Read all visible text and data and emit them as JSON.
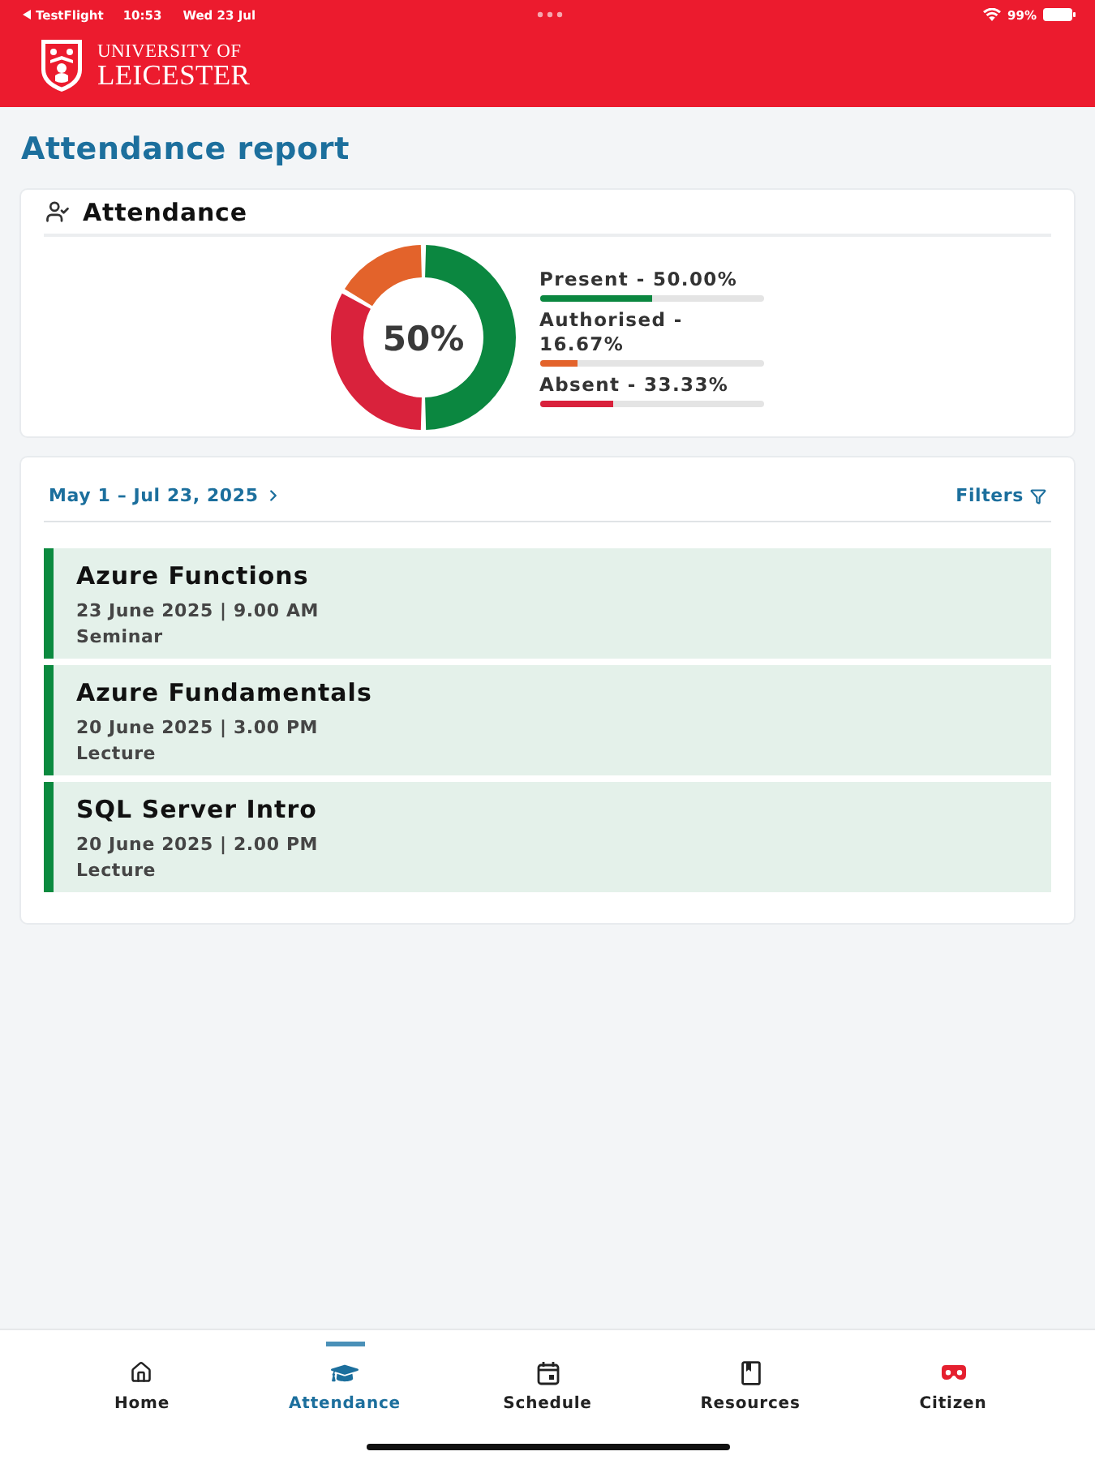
{
  "status_bar": {
    "back_label": "TestFlight",
    "time": "10:53",
    "date": "Wed 23 Jul",
    "battery": "99%"
  },
  "header": {
    "logo_lines": [
      "UNIVERSITY OF",
      "LEICESTER"
    ]
  },
  "page_title": "Attendance report",
  "attendance_card": {
    "title": "Attendance",
    "center_label": "50%",
    "chart_data": {
      "type": "donut",
      "categories": [
        "Present - 50.00%",
        "Authorised - 16.67%",
        "Absent - 33.33%"
      ],
      "values": [
        50,
        16.67,
        33.33
      ]
    },
    "legend": [
      {
        "level": 0.5,
        "color": "#0b8740"
      },
      {
        "level": 0.1667,
        "color": "#e3632b"
      },
      {
        "level": 0.3333,
        "color": "#d9223c"
      }
    ]
  },
  "sessions_card": {
    "date_range": "May 1 – Jul 23, 2025",
    "filters_label": "Filters",
    "sessions": [
      {
        "title": "Azure Functions",
        "date": "23 June 2025 | 9.00 AM",
        "type": "Seminar",
        "color": "#0b8a3f"
      },
      {
        "title": "Azure Fundamentals",
        "date": "20 June 2025 | 3.00 PM",
        "type": "Lecture",
        "color": "#0b8a3f"
      },
      {
        "title": "SQL Server Intro",
        "date": "20 June 2025 | 2.00 PM",
        "type": "Lecture",
        "color": "#0b8a3f"
      }
    ]
  },
  "tab_bar": {
    "tabs": [
      {
        "label": "Home",
        "kind": "home",
        "selected": false
      },
      {
        "label": "Attendance",
        "kind": "attendance",
        "selected": true
      },
      {
        "label": "Schedule",
        "kind": "schedule",
        "selected": false
      },
      {
        "label": "Resources",
        "kind": "resources",
        "selected": false
      },
      {
        "label": "Citizen",
        "kind": "citizen",
        "selected": false
      }
    ]
  }
}
